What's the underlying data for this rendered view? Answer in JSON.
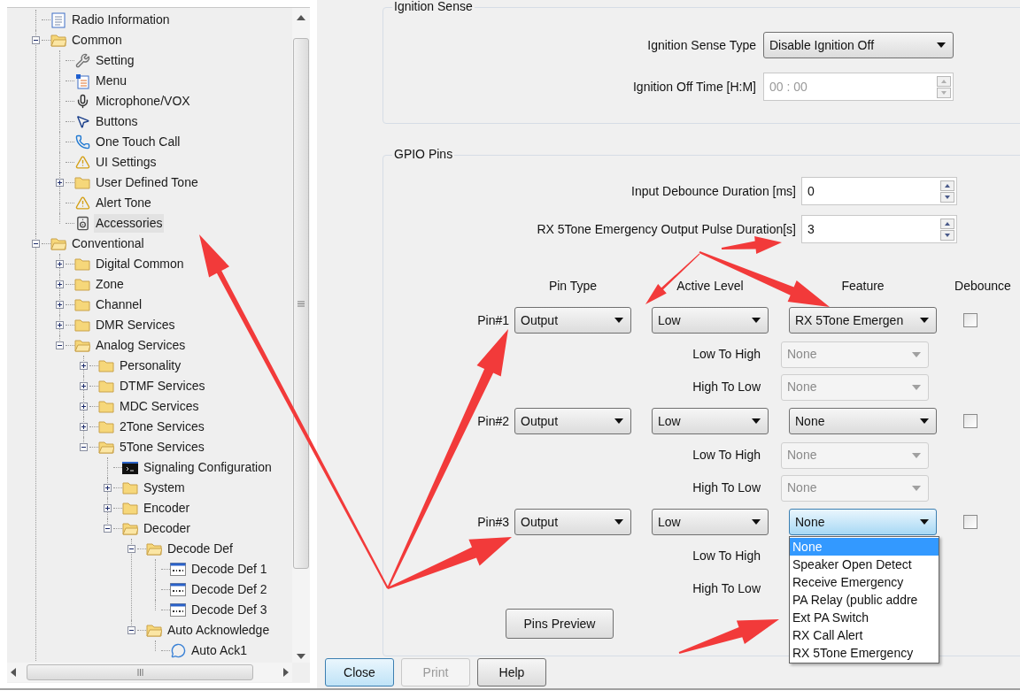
{
  "tree": [
    {
      "label": "Radio Information",
      "kind": "document",
      "selected": false
    },
    {
      "label": "Common",
      "kind": "folder",
      "expanded": true,
      "selected": false,
      "children": [
        {
          "label": "Setting",
          "kind": "wrench",
          "selected": false
        },
        {
          "label": "Menu",
          "kind": "menu",
          "selected": false
        },
        {
          "label": "Microphone/VOX",
          "kind": "microphone",
          "selected": false
        },
        {
          "label": "Buttons",
          "kind": "pointer",
          "selected": false
        },
        {
          "label": "One Touch Call",
          "kind": "phone",
          "selected": false
        },
        {
          "label": "UI Settings",
          "kind": "alert",
          "selected": false
        },
        {
          "label": "User Defined Tone",
          "kind": "folder",
          "expanded": false,
          "selected": false
        },
        {
          "label": "Alert Tone",
          "kind": "alert",
          "selected": false
        },
        {
          "label": "Accessories",
          "kind": "accessory",
          "selected": true
        }
      ]
    },
    {
      "label": "Conventional",
      "kind": "folder",
      "expanded": true,
      "selected": false,
      "children": [
        {
          "label": "Digital Common",
          "kind": "folder",
          "expanded": false,
          "selected": false
        },
        {
          "label": "Zone",
          "kind": "folder",
          "expanded": false,
          "selected": false
        },
        {
          "label": "Channel",
          "kind": "folder",
          "expanded": false,
          "selected": false
        },
        {
          "label": "DMR Services",
          "kind": "folder",
          "expanded": false,
          "selected": false
        },
        {
          "label": "Analog Services",
          "kind": "folder",
          "expanded": true,
          "selected": false,
          "children": [
            {
              "label": "Personality",
              "kind": "folder",
              "expanded": false,
              "selected": false
            },
            {
              "label": "DTMF Services",
              "kind": "folder",
              "expanded": false,
              "selected": false
            },
            {
              "label": "MDC Services",
              "kind": "folder",
              "expanded": false,
              "selected": false
            },
            {
              "label": "2Tone Services",
              "kind": "folder",
              "expanded": false,
              "selected": false
            },
            {
              "label": "5Tone Services",
              "kind": "folder",
              "expanded": true,
              "selected": false,
              "children": [
                {
                  "label": "Signaling Configuration",
                  "kind": "terminal",
                  "selected": false
                },
                {
                  "label": "System",
                  "kind": "folder",
                  "expanded": false,
                  "selected": false
                },
                {
                  "label": "Encoder",
                  "kind": "folder",
                  "expanded": false,
                  "selected": false
                },
                {
                  "label": "Decoder",
                  "kind": "folder",
                  "expanded": true,
                  "selected": false,
                  "children": [
                    {
                      "label": "Decode Def",
                      "kind": "folder",
                      "expanded": true,
                      "selected": false,
                      "children": [
                        {
                          "label": "Decode Def 1",
                          "kind": "decode",
                          "selected": false
                        },
                        {
                          "label": "Decode Def 2",
                          "kind": "decode",
                          "selected": false
                        },
                        {
                          "label": "Decode Def 3",
                          "kind": "decode",
                          "selected": false
                        }
                      ]
                    },
                    {
                      "label": "Auto Acknowledge",
                      "kind": "folder",
                      "expanded": true,
                      "selected": false,
                      "children": [
                        {
                          "label": "Auto Ack1",
                          "kind": "chat",
                          "selected": false
                        }
                      ]
                    }
                  ]
                }
              ]
            }
          ]
        }
      ]
    }
  ],
  "ignition_sense": {
    "title": "Ignition Sense",
    "type_label": "Ignition Sense Type",
    "type_value": "Disable Ignition Off",
    "off_time_label": "Ignition Off Time [H:M]",
    "off_time_value": "00 : 00",
    "off_time_disabled": true
  },
  "gpio": {
    "title": "GPIO Pins",
    "fields": [
      {
        "label": "Input Debounce Duration [ms]",
        "value": "0"
      },
      {
        "label": "RX 5Tone Emergency Output Pulse Duration[s]",
        "value": "3"
      }
    ],
    "columns": [
      "Pin Type",
      "Active Level",
      "Feature",
      "Debounce"
    ],
    "pins": [
      {
        "label": "Pin#1",
        "pin_type": "Output",
        "active_level": "Low",
        "feature": "RX 5Tone Emergen",
        "feature_open": false,
        "debounce_checked": false,
        "transitions": [
          {
            "label": "Low To High",
            "value": "None",
            "disabled": true
          },
          {
            "label": "High To Low",
            "value": "None",
            "disabled": true
          }
        ]
      },
      {
        "label": "Pin#2",
        "pin_type": "Output",
        "active_level": "Low",
        "feature": "None",
        "feature_open": false,
        "debounce_checked": false,
        "transitions": [
          {
            "label": "Low To High",
            "value": "None",
            "disabled": true
          },
          {
            "label": "High To Low",
            "value": "None",
            "disabled": true
          }
        ]
      },
      {
        "label": "Pin#3",
        "pin_type": "Output",
        "active_level": "Low",
        "feature": "None",
        "feature_open": true,
        "debounce_checked": false,
        "transitions": [
          {
            "label": "Low To High"
          },
          {
            "label": "High To Low"
          }
        ]
      }
    ],
    "feature_options": [
      {
        "label": "None",
        "selected": true
      },
      {
        "label": "Speaker Open Detect",
        "selected": false
      },
      {
        "label": "Receive Emergency",
        "selected": false
      },
      {
        "label": "PA Relay (public addre",
        "selected": false
      },
      {
        "label": "Ext PA Switch",
        "selected": false
      },
      {
        "label": "RX Call Alert",
        "selected": false
      },
      {
        "label": "RX 5Tone Emergency",
        "selected": false
      }
    ],
    "preview_button": "Pins Preview"
  },
  "buttons": [
    {
      "label": "Close",
      "default": true,
      "disabled": false
    },
    {
      "label": "Print",
      "default": false,
      "disabled": true
    },
    {
      "label": "Help",
      "default": false,
      "disabled": false
    }
  ]
}
